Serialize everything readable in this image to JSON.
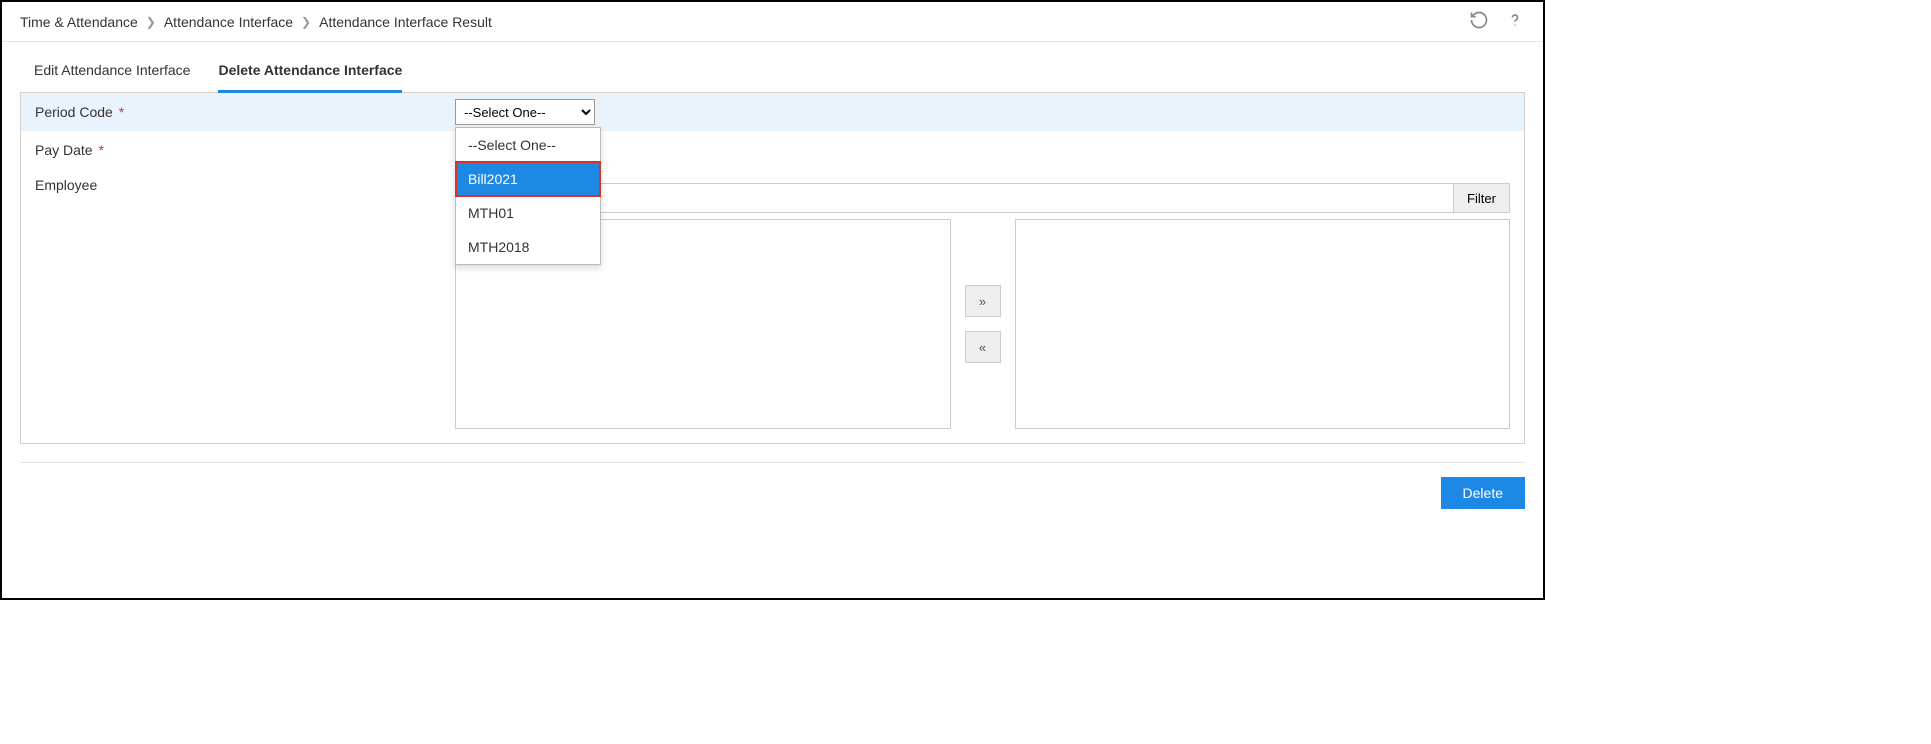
{
  "breadcrumb": {
    "level1": "Time & Attendance",
    "level2": "Attendance Interface",
    "level3": "Attendance Interface Result"
  },
  "tabs": {
    "edit": "Edit Attendance Interface",
    "delete": "Delete Attendance Interface"
  },
  "form": {
    "periodCode": {
      "label": "Period Code",
      "placeholder": "--Select One--"
    },
    "payDate": {
      "label": "Pay Date"
    },
    "employee": {
      "label": "Employee"
    },
    "filterButton": "Filter"
  },
  "dropdown": {
    "options": [
      "--Select One--",
      "Bill2021",
      "MTH01",
      "MTH2018"
    ]
  },
  "buttons": {
    "moveRight": "»",
    "moveLeft": "«",
    "delete": "Delete"
  }
}
